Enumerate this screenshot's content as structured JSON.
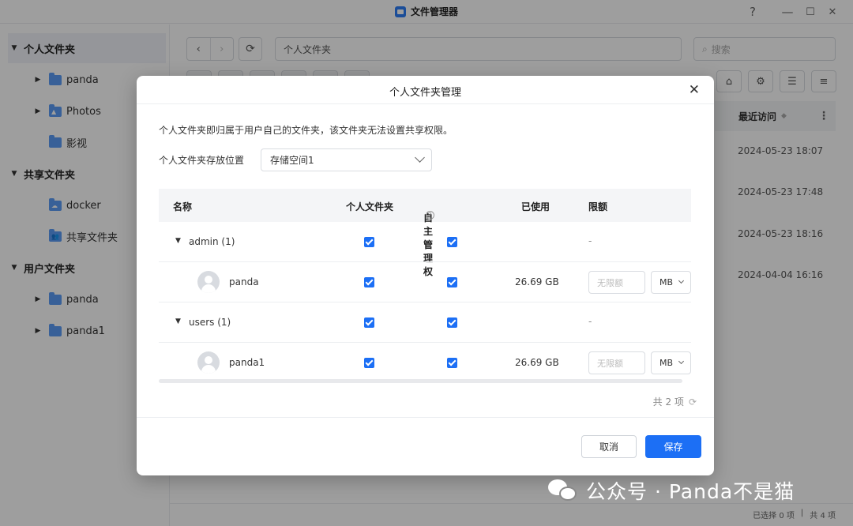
{
  "window": {
    "title": "文件管理器",
    "help": "?",
    "minimize": "—",
    "maximize": "☐",
    "close": "✕"
  },
  "sidebar": {
    "groups": [
      {
        "label": "个人文件夹",
        "items": [
          {
            "label": "panda",
            "icon": "folder-icon"
          },
          {
            "label": "Photos",
            "icon": "photo-folder-icon"
          },
          {
            "label": "影视",
            "icon": "folder-icon"
          }
        ]
      },
      {
        "label": "共享文件夹",
        "items": [
          {
            "label": "docker",
            "icon": "cloud-folder-icon"
          },
          {
            "label": "共享文件夹",
            "icon": "shared-folder-icon"
          }
        ]
      },
      {
        "label": "用户文件夹",
        "items": [
          {
            "label": "panda",
            "icon": "folder-icon"
          },
          {
            "label": "panda1",
            "icon": "folder-icon"
          }
        ]
      }
    ]
  },
  "toolbar": {
    "back": "‹",
    "forward": "›",
    "refresh": "⟳",
    "path": "个人文件夹",
    "search_placeholder": "搜索"
  },
  "background_table": {
    "column": "最近访问",
    "dates": [
      "2024-05-23 18:07",
      "2024-05-23 17:48",
      "2024-05-23 18:16",
      "2024-04-04 16:16"
    ]
  },
  "status": {
    "selected": "已选择 0 项",
    "total": "共 4 项"
  },
  "dialog": {
    "title": "个人文件夹管理",
    "description": "个人文件夹即归属于用户自己的文件夹，该文件夹无法设置共享权限。",
    "location_label": "个人文件夹存放位置",
    "location_value": "存储空间1",
    "columns": {
      "name": "名称",
      "personal": "个人文件夹",
      "admin": "自主管理权",
      "used": "已使用",
      "quota": "限额"
    },
    "rows": [
      {
        "type": "group",
        "name": "admin (1)",
        "quota": "-"
      },
      {
        "type": "user",
        "name": "panda",
        "used": "26.69 GB",
        "quota_placeholder": "无限额",
        "unit": "MB"
      },
      {
        "type": "group",
        "name": "users (1)",
        "quota": "-"
      },
      {
        "type": "user",
        "name": "panda1",
        "used": "26.69 GB",
        "quota_placeholder": "无限额",
        "unit": "MB"
      }
    ],
    "count": "共 2 项",
    "cancel": "取消",
    "save": "保存"
  },
  "watermark": "公众号 · Panda不是猫",
  "colors": {
    "accent": "#1c6ff5",
    "folder": "#5b9cf6"
  }
}
